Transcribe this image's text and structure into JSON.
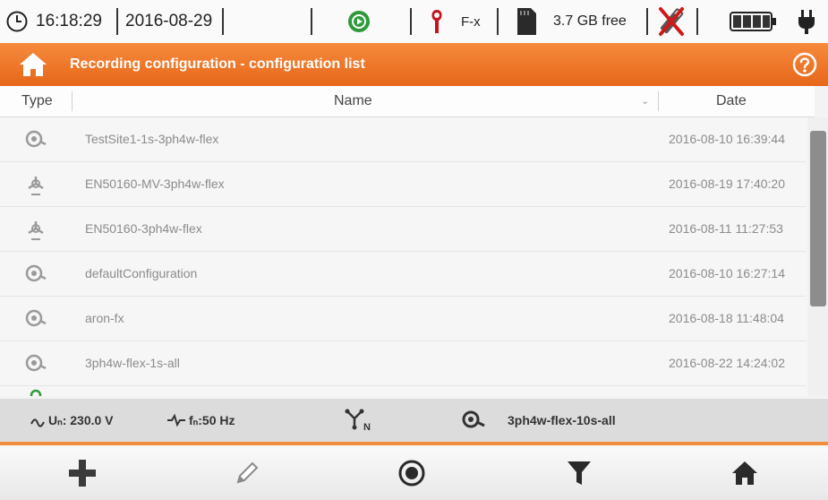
{
  "status": {
    "time": "16:18:29",
    "date": "2016-08-29",
    "probe": "F-x",
    "free_space": "3.7 GB free"
  },
  "title": "Recording configuration - configuration list",
  "columns": {
    "type": "Type",
    "name": "Name",
    "date": "Date"
  },
  "rows": [
    {
      "icon": "power-meter-icon",
      "name": "TestSite1-1s-3ph4w-flex",
      "date": "2016-08-10 16:39:44"
    },
    {
      "icon": "star-configuration-icon",
      "name": "EN50160-MV-3ph4w-flex",
      "date": "2016-08-19 17:40:20"
    },
    {
      "icon": "star-configuration-icon",
      "name": "EN50160-3ph4w-flex",
      "date": "2016-08-11 11:27:53"
    },
    {
      "icon": "power-meter-icon",
      "name": "defaultConfiguration",
      "date": "2016-08-10 16:27:14"
    },
    {
      "icon": "power-meter-icon",
      "name": "aron-fx",
      "date": "2016-08-18 11:48:04"
    },
    {
      "icon": "power-meter-icon",
      "name": "3ph4w-flex-1s-all",
      "date": "2016-08-22 14:24:02"
    }
  ],
  "info": {
    "voltage": "Uₙ: 230.0 V",
    "frequency": "fₙ:50 Hz",
    "active_config": "3ph4w-flex-10s-all"
  },
  "colors": {
    "accent": "#ee7623",
    "scrollbar": "#8d8d8d"
  }
}
